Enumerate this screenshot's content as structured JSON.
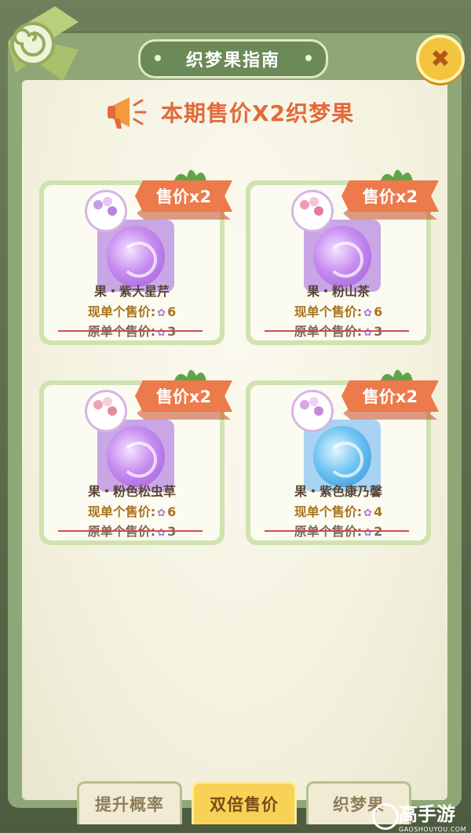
{
  "dialog": {
    "title": "织梦果指南",
    "close_label": "✖",
    "promo": "本期售价X2织梦果"
  },
  "cards": [
    {
      "tag": "售价x2",
      "name": "果・紫大星芹",
      "now_label": "现单个售价:",
      "now_value": "6",
      "orig_label": "原单个售价:",
      "orig_value": "3",
      "color": "purple"
    },
    {
      "tag": "售价x2",
      "name": "果・粉山茶",
      "now_label": "现单个售价:",
      "now_value": "6",
      "orig_label": "原单个售价:",
      "orig_value": "3",
      "color": "purple"
    },
    {
      "tag": "售价x2",
      "name": "果・粉色松虫草",
      "now_label": "现单个售价:",
      "now_value": "6",
      "orig_label": "原单个售价:",
      "orig_value": "3",
      "color": "purple"
    },
    {
      "tag": "售价x2",
      "name": "果・紫色康乃馨",
      "now_label": "现单个售价:",
      "now_value": "4",
      "orig_label": "原单个售价:",
      "orig_value": "2",
      "color": "blue"
    }
  ],
  "tabs": [
    {
      "label": "提升概率",
      "active": false
    },
    {
      "label": "双倍售价",
      "active": true
    },
    {
      "label": "织梦果",
      "active": false
    }
  ],
  "watermark": {
    "title": "高手游",
    "subtitle": "GAOSHOUYOU.COM"
  },
  "colors": {
    "panel": "#8fa777",
    "tag": "#ec7a4a",
    "active_tab": "#f7d257",
    "price_now": "#a8731e",
    "strike": "#d64a4a"
  },
  "icons": {
    "close": "close-icon",
    "promo": "megaphone-icon",
    "currency": "butterfly-icon"
  }
}
